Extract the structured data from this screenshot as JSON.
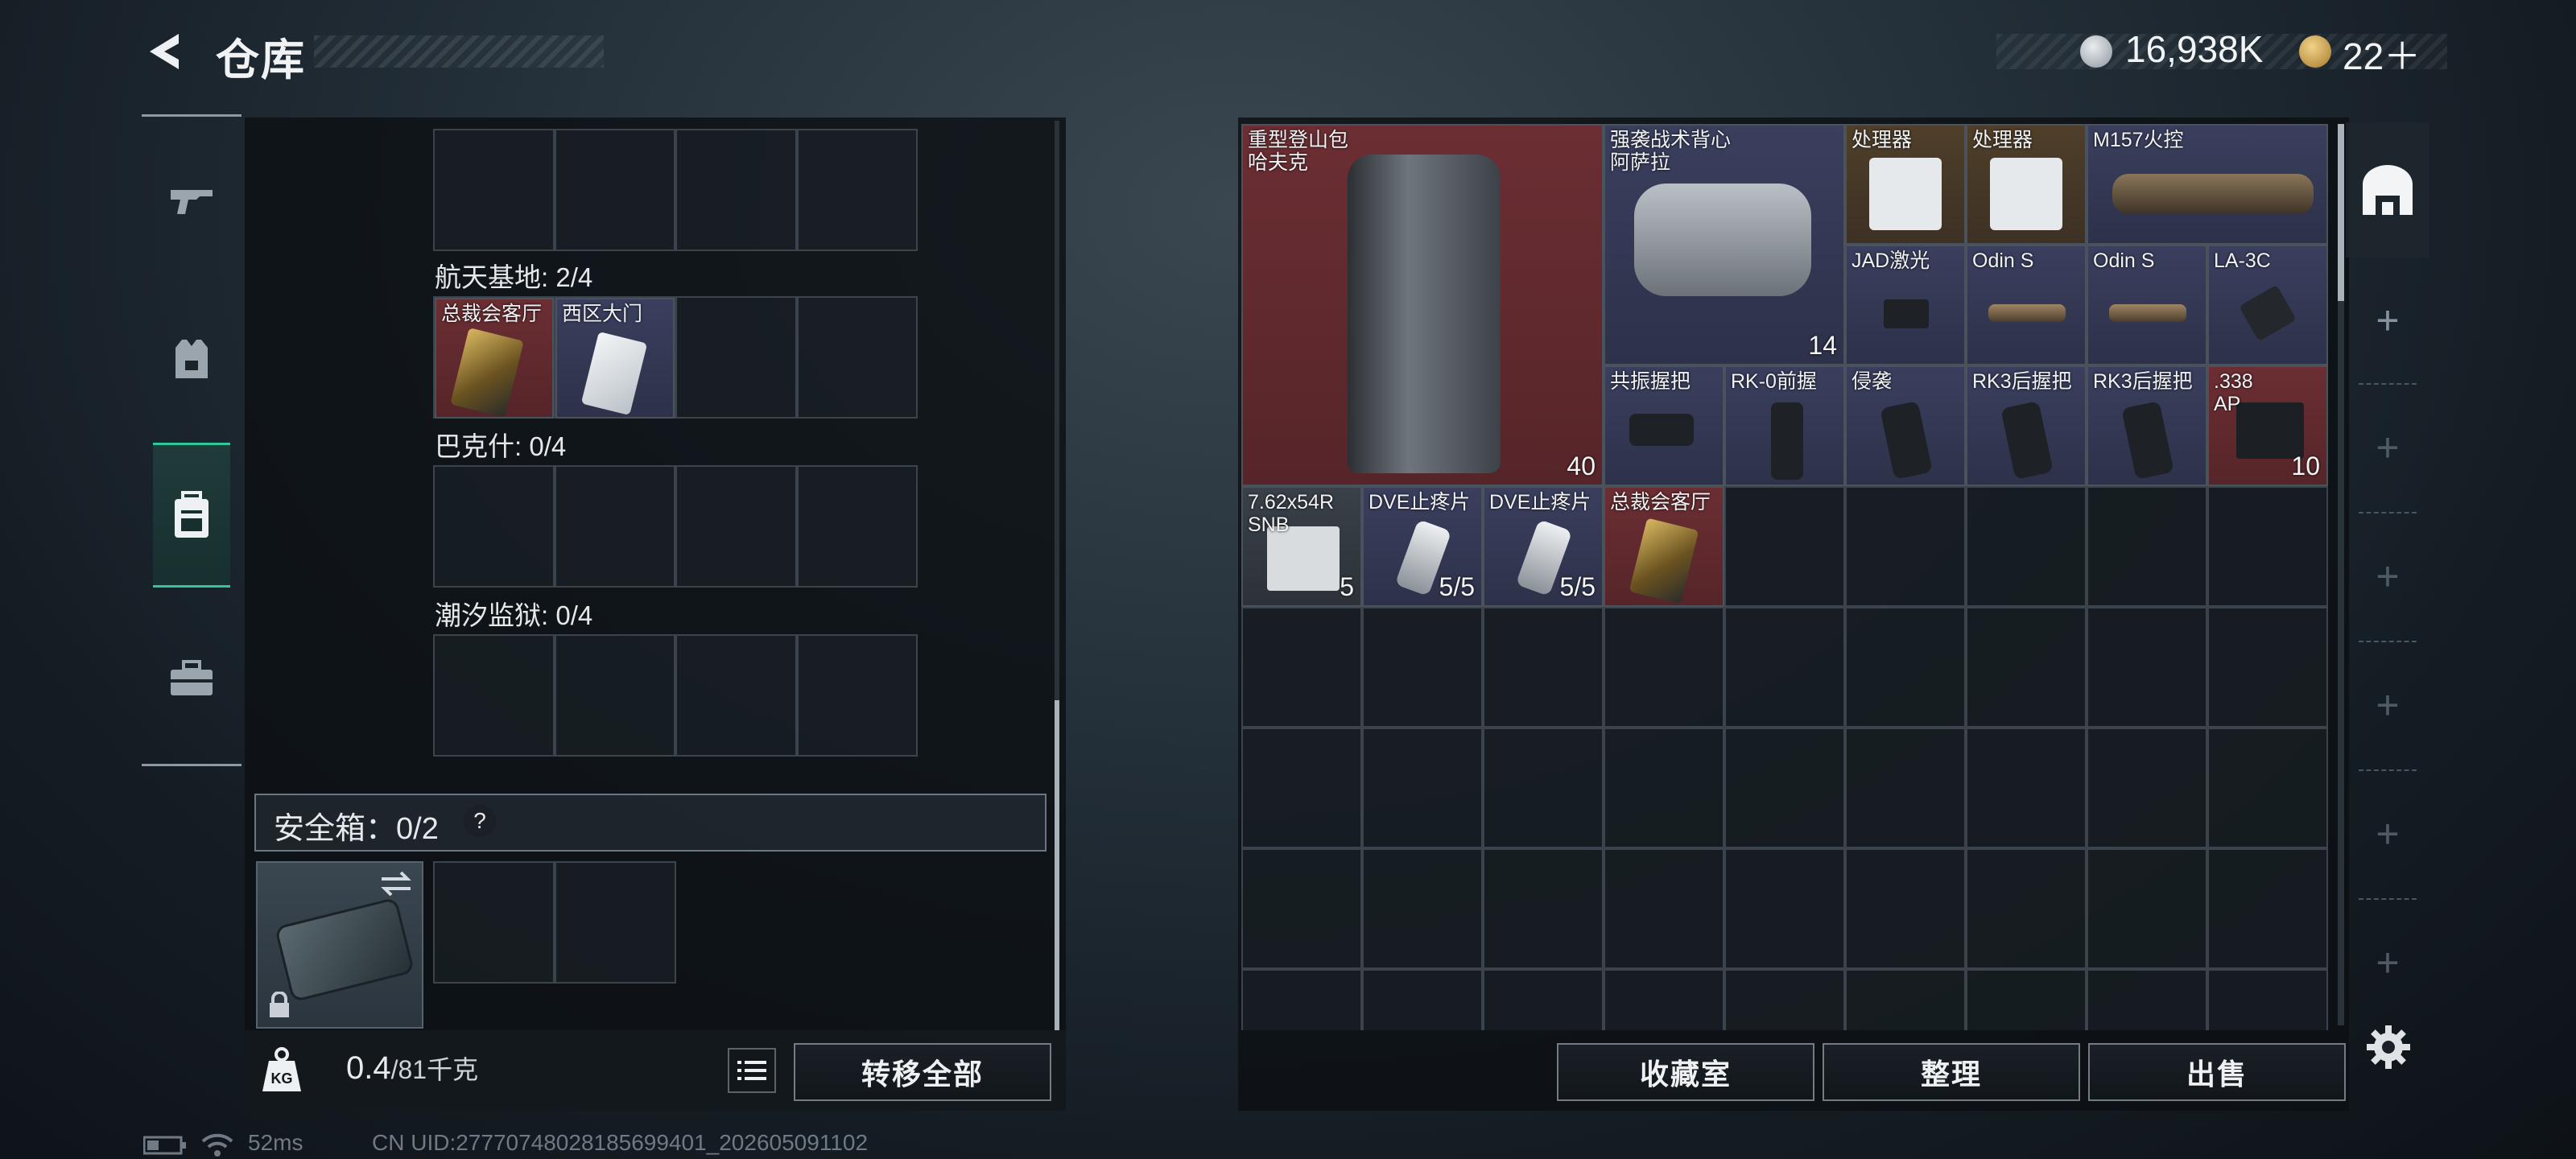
{
  "header": {
    "title": "仓库",
    "currency_silver": "16,938K",
    "currency_gold": "22＋"
  },
  "left": {
    "sections": [
      {
        "label": "航天基地: 2/4"
      },
      {
        "label": "巴克什: 0/4"
      },
      {
        "label": "潮汐监狱: 0/4"
      }
    ],
    "keys": [
      {
        "name": "总裁会客厅"
      },
      {
        "name": "西区大门"
      }
    ],
    "safe": {
      "label": "安全箱：0/2",
      "help": "?"
    },
    "weight": {
      "current": "0.4",
      "max": "/81千克"
    },
    "transfer_label": "转移全部"
  },
  "right": {
    "items": [
      {
        "name": "重型登山包\n哈夫克",
        "count": "40"
      },
      {
        "name": "强袭战术背心\n阿萨拉",
        "count": "14"
      },
      {
        "name": "处理器"
      },
      {
        "name": "处理器"
      },
      {
        "name": "M157火控"
      },
      {
        "name": "JAD激光"
      },
      {
        "name": "Odin S"
      },
      {
        "name": "Odin S"
      },
      {
        "name": "LA-3C"
      },
      {
        "name": "共振握把"
      },
      {
        "name": "RK-0前握"
      },
      {
        "name": "侵袭"
      },
      {
        "name": "RK3后握把"
      },
      {
        "name": "RK3后握把"
      },
      {
        "name": ".338\nAP",
        "count": "10"
      },
      {
        "name": "7.62x54R\nSNB",
        "count": "5"
      },
      {
        "name": "DVE止疼片",
        "count": "5/5"
      },
      {
        "name": "DVE止疼片",
        "count": "5/5"
      },
      {
        "name": "总裁会客厅"
      }
    ],
    "buttons": {
      "vault": "收藏室",
      "sort": "整理",
      "sell": "出售"
    }
  },
  "status": {
    "ping": "52ms",
    "uid": "CN UID:27770748028185699401_202605091102"
  },
  "colors": {
    "accent": "#2ec79a",
    "rarity_red": "#6b2e33",
    "rarity_gold": "#4f3f2a",
    "rarity_purple": "#3a3f5e"
  }
}
